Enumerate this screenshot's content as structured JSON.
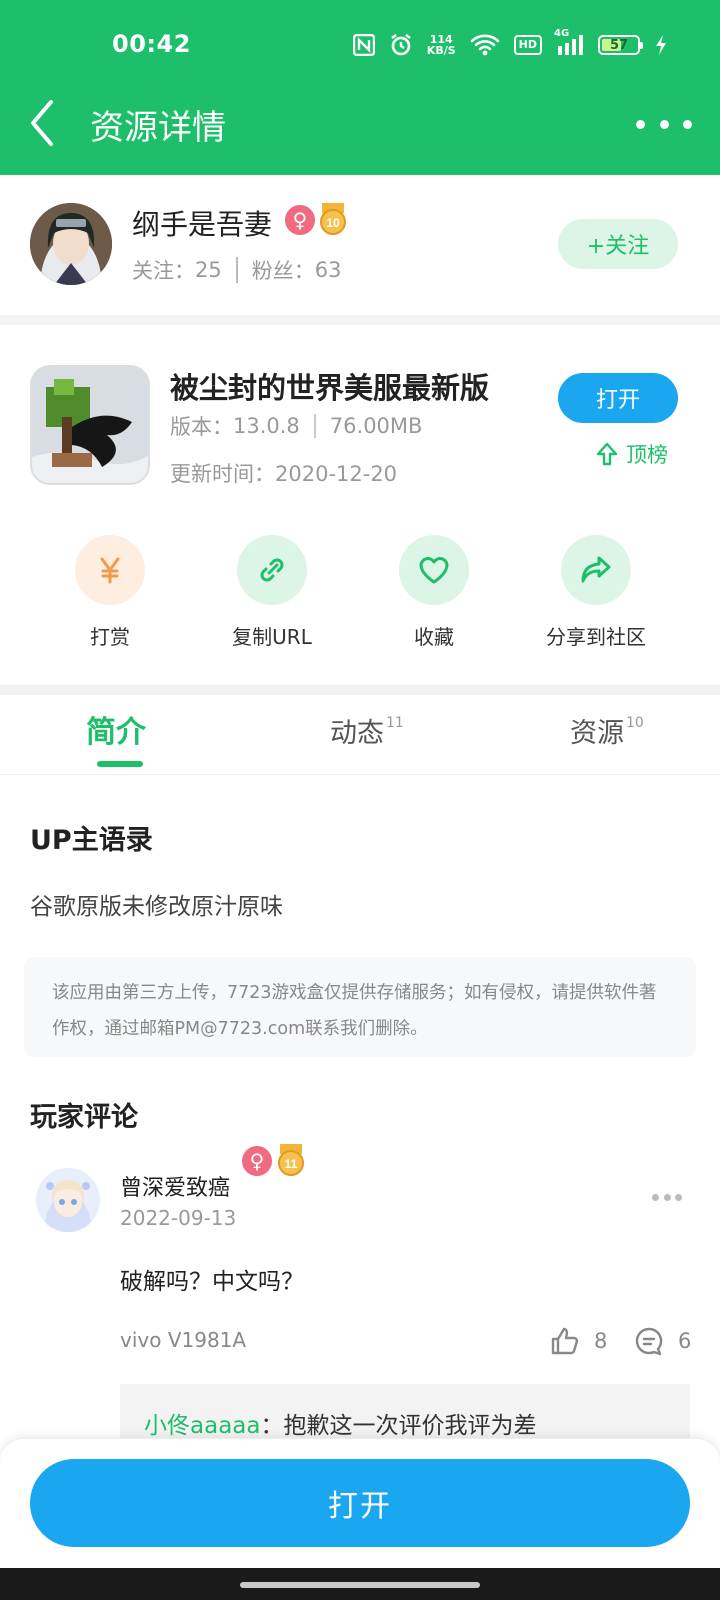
{
  "status_bar": {
    "time": "00:42",
    "net_speed_value": "114",
    "net_speed_unit": "KB/S",
    "hd_label": "HD",
    "signal_label": "4G",
    "battery": "57",
    "battery_level": 0.57,
    "icons": [
      "nfc-icon",
      "alarm-icon",
      "wifi-icon",
      "hd-icon",
      "signal-icon",
      "battery-icon",
      "charging-icon"
    ]
  },
  "header": {
    "title": "资源详情",
    "back_icon": "chevron-left-icon",
    "more_icon": "more-horizontal-icon"
  },
  "author": {
    "name": "纲手是吾妻",
    "gender": "♀",
    "level": "10",
    "following_label": "关注：",
    "following": "25",
    "fans_label": "粉丝：",
    "fans": "63",
    "follow_button": "+关注"
  },
  "app": {
    "name": "被尘封的世界美服最新版",
    "version_label": "版本：",
    "version": "13.0.8",
    "size": "76.00MB",
    "update_label": "更新时间：",
    "update_date": "2020-12-20",
    "open_button": "打开",
    "rank_button": "顶榜"
  },
  "actions": [
    {
      "label": "打赏",
      "icon": "yen-icon",
      "color": "#f39a4c",
      "bg": "#fdeee1"
    },
    {
      "label": "复制URL",
      "icon": "link-icon",
      "color": "#1dbf6a",
      "bg": "#dcf5e6"
    },
    {
      "label": "收藏",
      "icon": "heart-icon",
      "color": "#1dbf6a",
      "bg": "#dcf5e6"
    },
    {
      "label": "分享到社区",
      "icon": "share-icon",
      "color": "#1dbf6a",
      "bg": "#dcf5e6"
    }
  ],
  "tabs": [
    {
      "label": "简介",
      "count": "",
      "active": true
    },
    {
      "label": "动态",
      "count": "11",
      "active": false
    },
    {
      "label": "资源",
      "count": "10",
      "active": false
    }
  ],
  "intro": {
    "up_title": "UP主语录",
    "up_quote": "谷歌原版未修改原汁原味",
    "notice": "该应用由第三方上传，7723游戏盒仅提供存储服务；如有侵权，请提供软件著作权，通过邮箱PM@7723.com联系我们删除。"
  },
  "comments": {
    "title": "玩家评论",
    "items": [
      {
        "user": "曾深爱致癌",
        "gender": "♀",
        "level": "11",
        "date": "2022-09-13",
        "text": "破解吗？中文吗？",
        "device": "vivo V1981A",
        "likes": "8",
        "replies": "6",
        "reply_user": "小佟aaaaa",
        "reply_sep": "：",
        "reply_text": "抱歉这一次评价我评为差"
      }
    ]
  },
  "bottom": {
    "open_button": "打开"
  },
  "colors": {
    "brand_green": "#1dbf6a",
    "button_blue": "#1aa7f0",
    "female_pink": "#f06b7f",
    "level_gold": "#f2b43a"
  }
}
